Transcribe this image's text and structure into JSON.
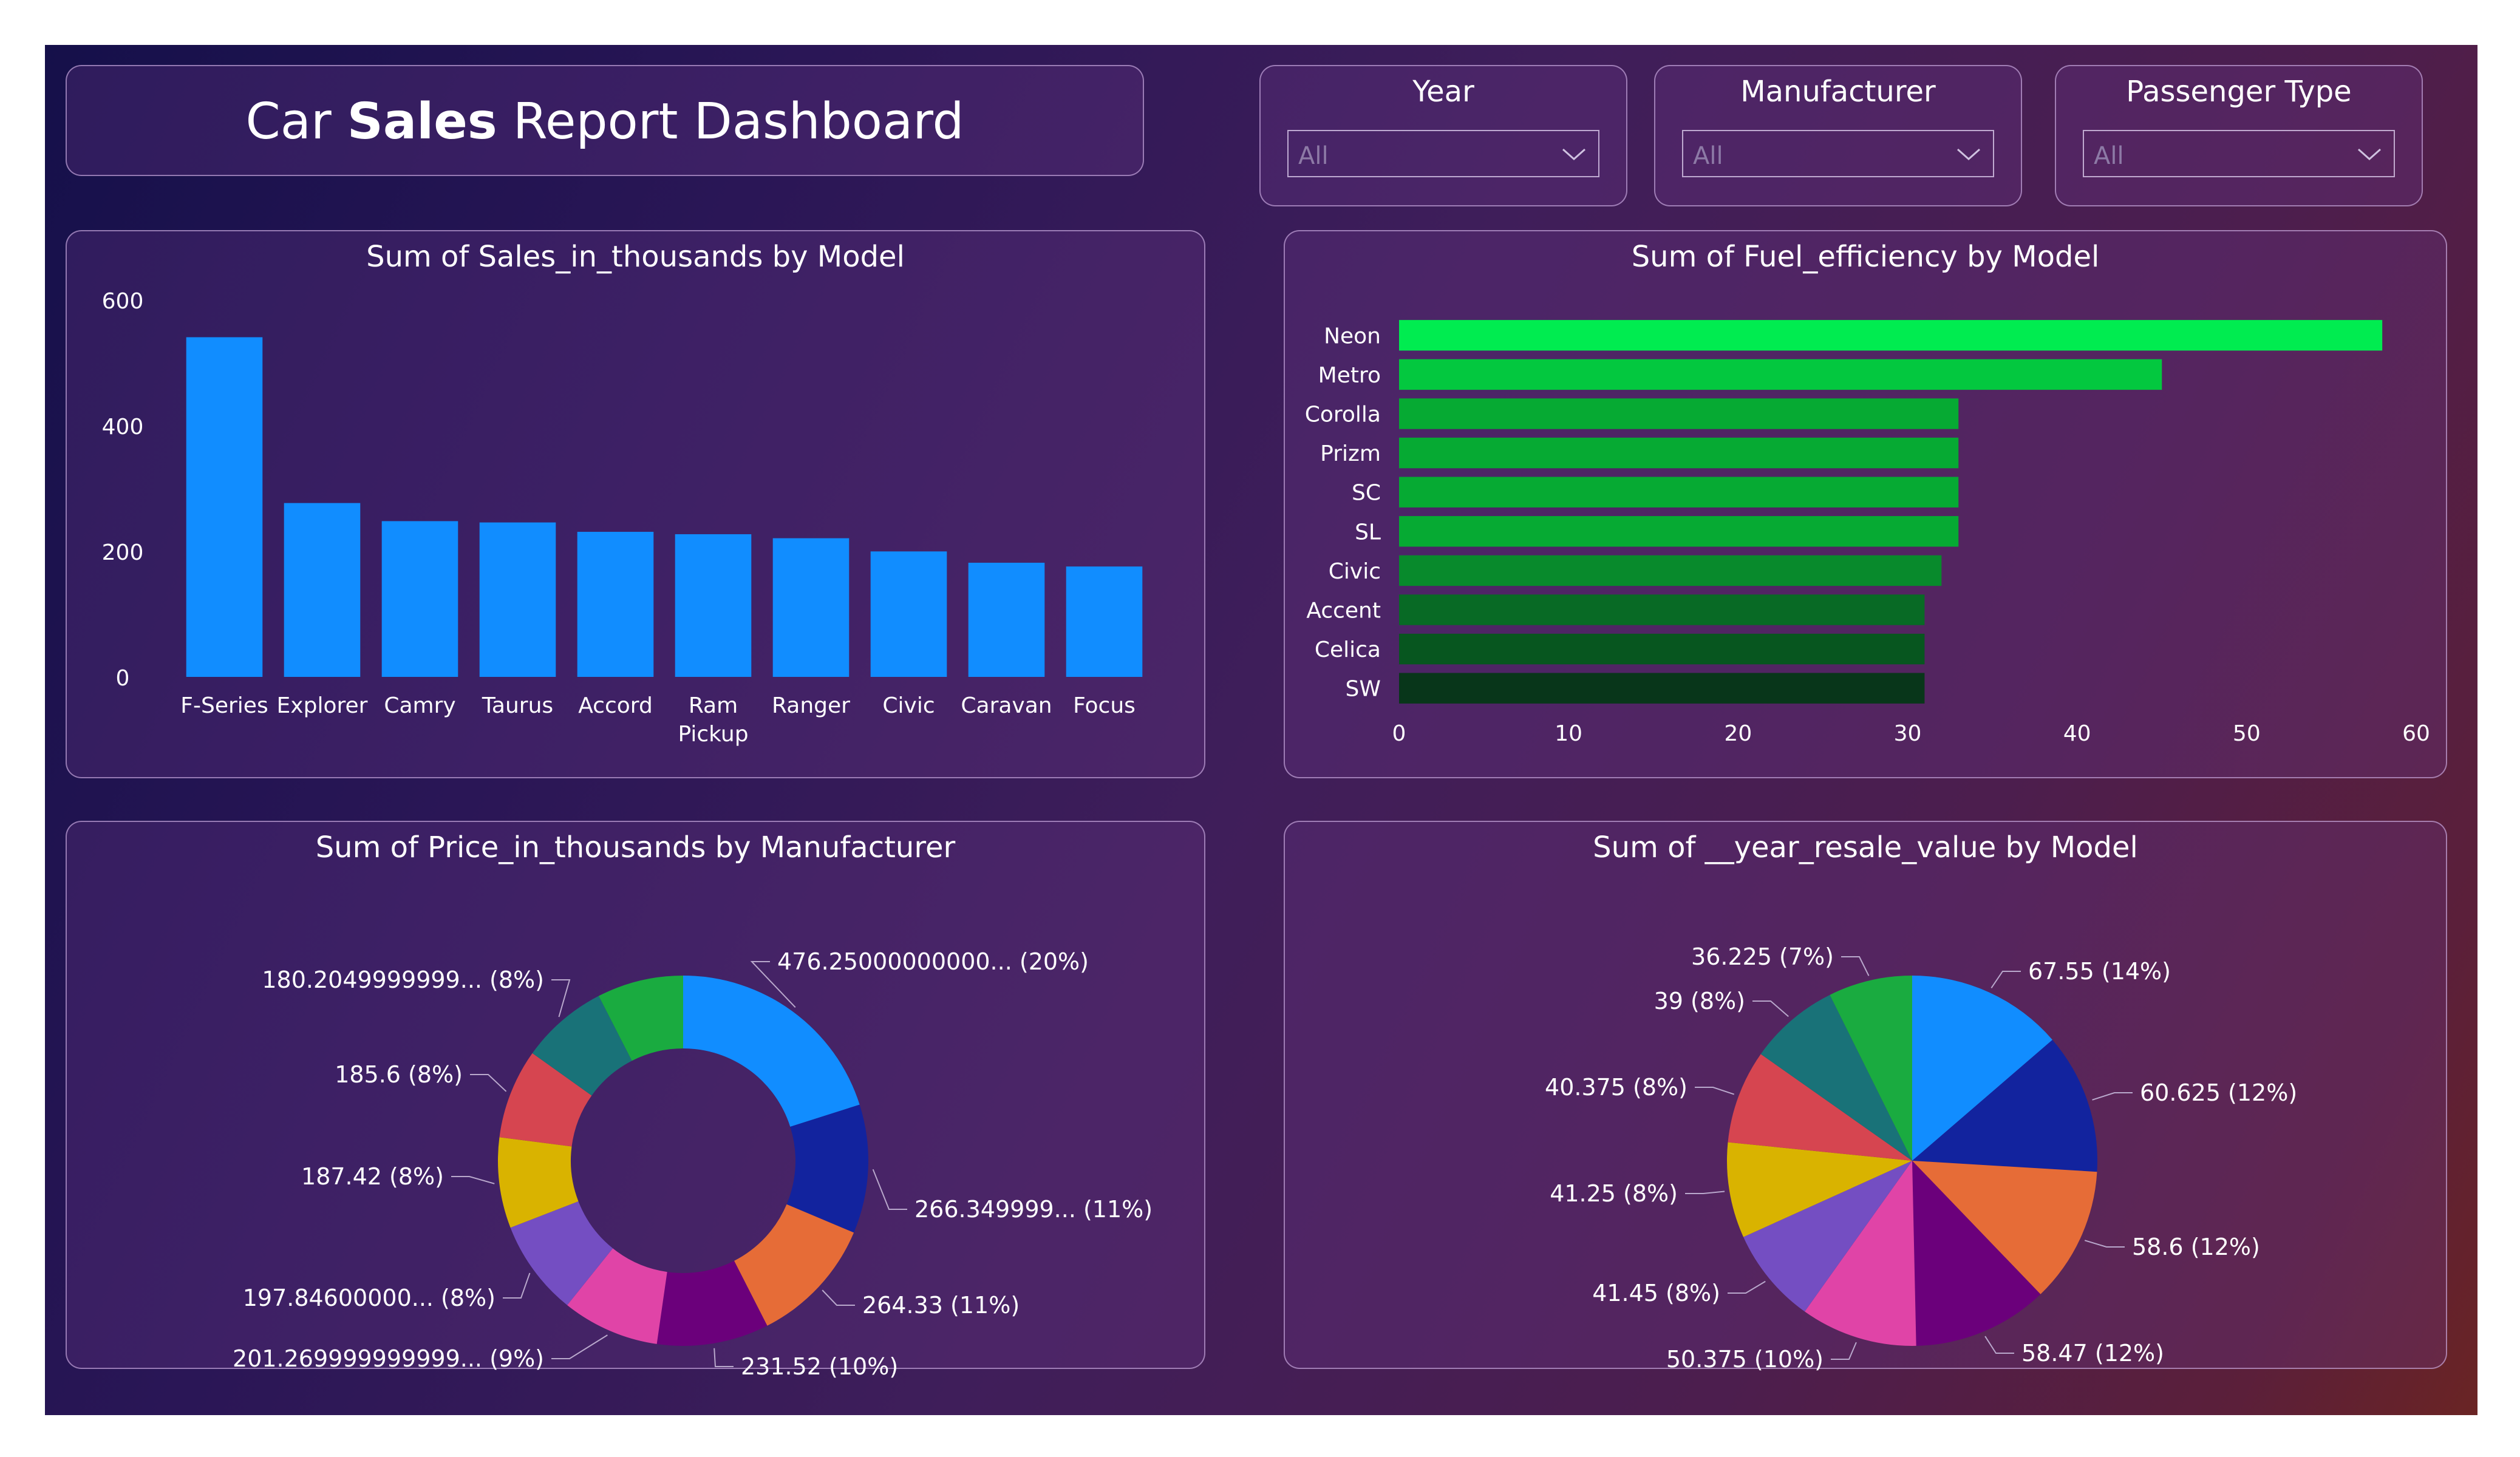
{
  "dashboard": {
    "title_pre": "Car ",
    "title_bold": "Sales",
    "title_post": " Report Dashboard"
  },
  "slicers": [
    {
      "label": "Year",
      "value": "All",
      "icon": "chevron-down-icon"
    },
    {
      "label": "Manufacturer",
      "value": "All",
      "icon": "chevron-down-icon"
    },
    {
      "label": "Passenger Type",
      "value": "All",
      "icon": "chevron-down-icon"
    }
  ],
  "chart_data": [
    {
      "type": "bar",
      "orientation": "vertical",
      "title": "Sum of Sales_in_thousands by Model",
      "categories": [
        "F-Series",
        "Explorer",
        "Camry",
        "Taurus",
        "Accord",
        "Ram Pickup",
        "Ranger",
        "Civic",
        "Caravan",
        "Focus"
      ],
      "values": [
        540.6,
        276.7,
        247.9,
        245.8,
        230.9,
        227.1,
        220.7,
        199.7,
        181.7,
        175.7
      ],
      "ylim": [
        0,
        600
      ],
      "yticks": [
        "0",
        "200",
        "400",
        "600"
      ],
      "xlabel": "",
      "ylabel": "",
      "color": "#118dff",
      "grid": false
    },
    {
      "type": "bar",
      "orientation": "horizontal",
      "title": "Sum of Fuel_efficiency by Model",
      "categories": [
        "Neon",
        "Metro",
        "Corolla",
        "Prizm",
        "SC",
        "SL",
        "Civic",
        "Accent",
        "Celica",
        "SW"
      ],
      "values": [
        58,
        45,
        33,
        33,
        33,
        33,
        32,
        31,
        31,
        31
      ],
      "xlim": [
        0,
        60
      ],
      "xticks": [
        "0",
        "10",
        "20",
        "30",
        "40",
        "50",
        "60"
      ],
      "colors": [
        "#00ec50",
        "#03c83f",
        "#06aa33",
        "#06aa33",
        "#06aa33",
        "#06aa33",
        "#088a2c",
        "#086a25",
        "#07561f",
        "#08361a"
      ],
      "grid": false
    },
    {
      "type": "pie",
      "variant": "donut",
      "title": "Sum of Price_in_thousands by Manufacturer",
      "values": [
        476.25,
        266.35,
        264.33,
        231.52,
        201.27,
        197.846,
        187.42,
        185.6,
        180.205
      ],
      "labels": [
        "476.25000000000... (20%)",
        "266.349999... (11%)",
        "264.33 (11%)",
        "231.52 (10%)",
        "201.269999999999... (9%)",
        "197.84600000... (8%)",
        "187.42 (8%)",
        "185.6 (8%)",
        "180.2049999999... (8%)"
      ],
      "extra_values": [
        178.5
      ],
      "colors": [
        "#118dff",
        "#12239e",
        "#e66c37",
        "#6b007b",
        "#e044a7",
        "#744ec2",
        "#d9b300",
        "#d64550",
        "#197278",
        "#1aab40"
      ]
    },
    {
      "type": "pie",
      "title": "Sum of __year_resale_value by Model",
      "values": [
        67.55,
        60.625,
        58.6,
        58.47,
        50.375,
        41.45,
        41.25,
        40.375,
        39,
        36.225
      ],
      "labels": [
        "67.55 (14%)",
        "60.625 (12%)",
        "58.6 (12%)",
        "58.47 (12%)",
        "50.375 (10%)",
        "41.45 (8%)",
        "41.25 (8%)",
        "40.375 (8%)",
        "39 (8%)",
        "36.225 (7%)"
      ],
      "colors": [
        "#118dff",
        "#12239e",
        "#e66c37",
        "#6b007b",
        "#e044a7",
        "#744ec2",
        "#d9b300",
        "#d64550",
        "#197278",
        "#1aab40"
      ]
    }
  ]
}
